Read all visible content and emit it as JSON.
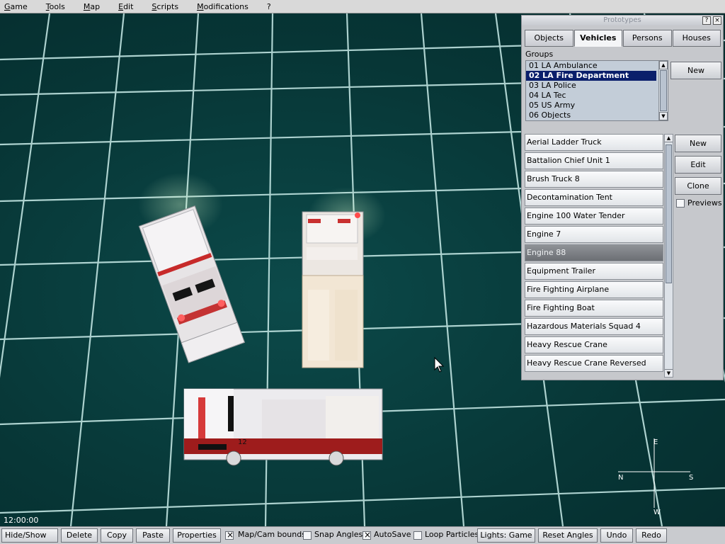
{
  "menu": {
    "items": [
      "Game",
      "Tools",
      "Map",
      "Edit",
      "Scripts",
      "Modifications",
      "?"
    ]
  },
  "viewport": {
    "clock": "12:00:00",
    "compass": {
      "north": "N",
      "east": "E",
      "south": "S",
      "west": "W"
    },
    "grid_color": "#bfe3e0",
    "background_color": "#07393a"
  },
  "prototypes": {
    "title": "Prototypes",
    "help_label": "?",
    "close_label": "×",
    "tabs": [
      "Objects",
      "Vehicles",
      "Persons",
      "Houses"
    ],
    "active_tab": "Vehicles",
    "groups_label": "Groups",
    "groups": [
      "01 LA Ambulance",
      "02 LA Fire Department",
      "03 LA Police",
      "04 LA Tec",
      "05 US Army",
      "06 Objects"
    ],
    "selected_group": "02 LA Fire Department",
    "group_new_label": "New",
    "vehicles": [
      "Aerial Ladder Truck",
      "Battalion Chief Unit 1",
      "Brush Truck 8",
      "Decontamination Tent",
      "Engine 100 Water Tender",
      "Engine 7",
      "Engine 88",
      "Equipment Trailer",
      "Fire Fighting Airplane",
      "Fire Fighting Boat",
      "Hazardous Materials Squad 4",
      "Heavy Rescue Crane",
      "Heavy Rescue Crane Reversed"
    ],
    "selected_vehicle": "Engine 88",
    "buttons": {
      "new": "New",
      "edit": "Edit",
      "clone": "Clone"
    },
    "previews_label": "Previews",
    "previews_checked": false
  },
  "toolbar": {
    "hide_show": "Hide/Show",
    "delete": "Delete",
    "copy": "Copy",
    "paste": "Paste",
    "properties": "Properties",
    "map_cam_bounds": "Map/Cam bounds",
    "map_cam_bounds_checked": true,
    "snap_angles": "Snap Angles",
    "snap_angles_checked": false,
    "autosave": "AutoSave",
    "autosave_checked": true,
    "loop_particles": "Loop Particles",
    "loop_particles_checked": false,
    "lights": "Lights: Game",
    "reset_angles": "Reset Angles",
    "undo": "Undo",
    "redo": "Redo"
  },
  "colors": {
    "selection": "#0a1f6b",
    "truck_red": "#9e1c1c",
    "truck_white": "#efeff2"
  },
  "truck_number": "12"
}
